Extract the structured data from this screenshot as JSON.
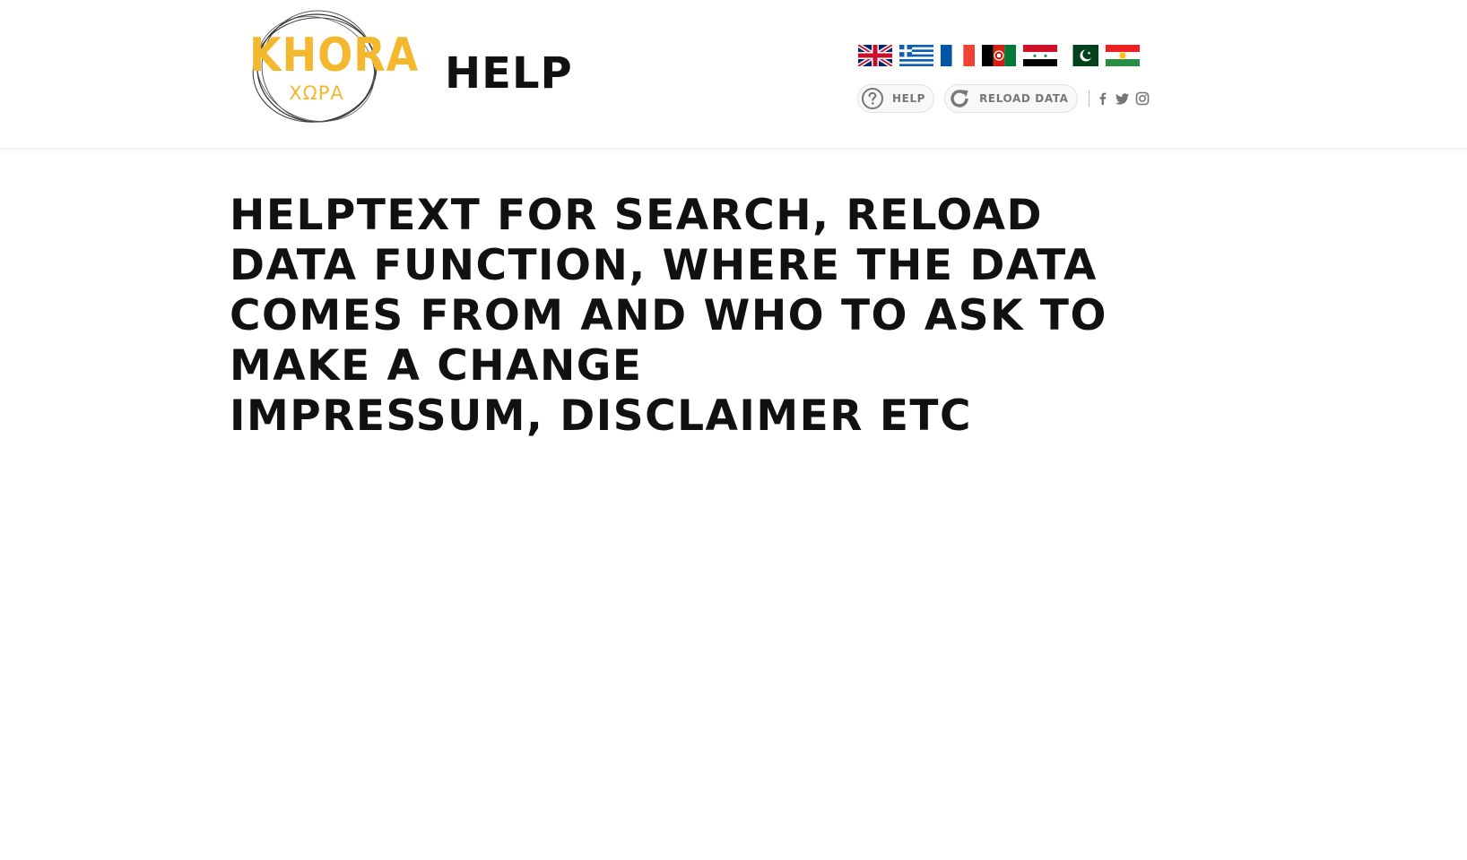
{
  "header": {
    "logo": {
      "word": "KHORA",
      "greek": "ΧΩΡΑ",
      "color": "#f4b82e"
    },
    "page_title": "HELP",
    "flags": [
      {
        "name": "flag-uk-icon"
      },
      {
        "name": "flag-greece-icon"
      },
      {
        "name": "flag-france-icon"
      },
      {
        "name": "flag-afghanistan-icon"
      },
      {
        "name": "flag-syria-icon"
      },
      {
        "name": "flag-pakistan-icon"
      },
      {
        "name": "flag-kurdistan-icon"
      }
    ],
    "toolbar": {
      "help_label": "HELP",
      "help_icon": "question-circle-icon",
      "reload_label": "RELOAD DATA",
      "reload_icon": "reload-icon",
      "social": [
        "facebook-icon",
        "twitter-icon",
        "instagram-icon"
      ]
    }
  },
  "main": {
    "heading_line1": "HELPTEXT FOR SEARCH, RELOAD DATA FUNCTION, WHERE THE DATA COMES FROM AND WHO TO ASK TO MAKE A CHANGE",
    "heading_line2": "IMPRESSUM, DISCLAIMER ETC"
  },
  "colors": {
    "accent": "#f4b82e",
    "text": "#111111",
    "muted": "#777777"
  }
}
